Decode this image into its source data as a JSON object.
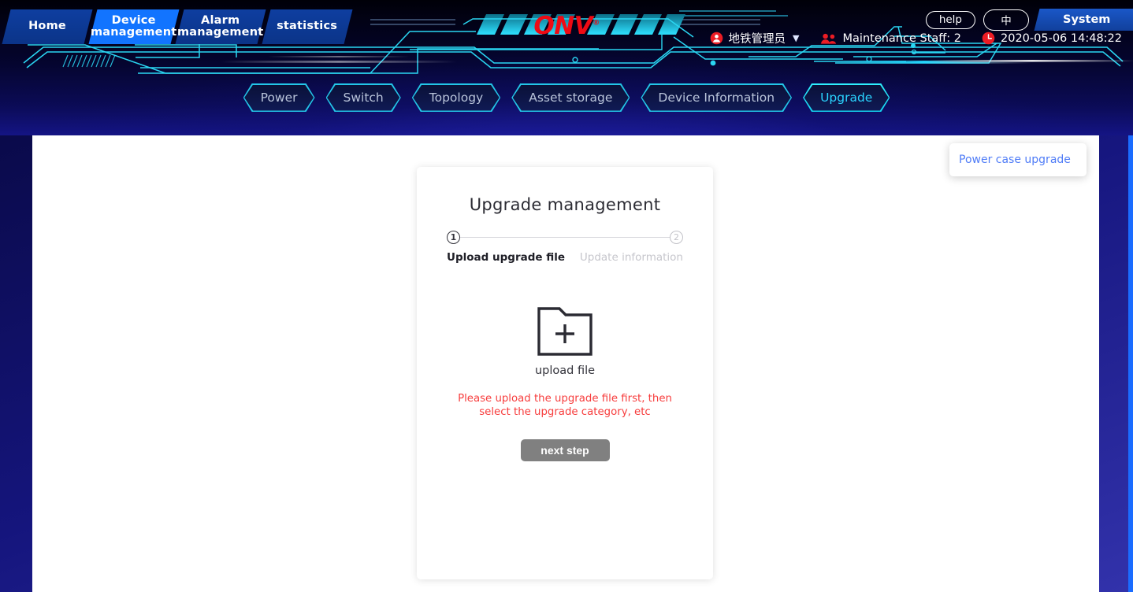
{
  "header": {
    "primary_nav": [
      {
        "label": "Home",
        "active": false
      },
      {
        "label": "Device\nmanagement",
        "line1": "Device",
        "line2": "management",
        "active": true
      },
      {
        "label": "Alarm\nmanagement",
        "line1": "Alarm",
        "line2": "management",
        "active": false
      },
      {
        "label": "statistics",
        "line1": "statistics",
        "line2": "",
        "active": false
      }
    ],
    "help_label": "help",
    "lang_label": "中",
    "system_label": "System",
    "user_name": "地铁管理员",
    "maintenance_staff": "Maintenance Staff: 2",
    "datetime": "2020-05-06 14:48:22",
    "logo_text": "ONV",
    "logo_mark": "®",
    "accent_cyan": "#23c6e8",
    "accent_red": "#ee0a14",
    "active_tab_blue": "#1274ff"
  },
  "subnav": {
    "items": [
      {
        "label": "Power",
        "active": false
      },
      {
        "label": "Switch",
        "active": false
      },
      {
        "label": "Topology",
        "active": false
      },
      {
        "label": "Asset storage",
        "active": false
      },
      {
        "label": "Device Information",
        "active": false
      },
      {
        "label": "Upgrade",
        "active": true
      }
    ]
  },
  "float_panel": {
    "label": "Power case upgrade",
    "text_color": "#4f7cf7"
  },
  "card": {
    "title": "Upgrade management",
    "steps": [
      {
        "num": "1",
        "label": "Upload upgrade file",
        "active": true
      },
      {
        "num": "2",
        "label": "Update information",
        "active": false
      }
    ],
    "upload_label": "upload file",
    "warning": "Please upload the upgrade file first, then select the upgrade category, etc",
    "warning_color": "#f73d3d",
    "next_button": "next step",
    "next_button_color": "#808080"
  }
}
